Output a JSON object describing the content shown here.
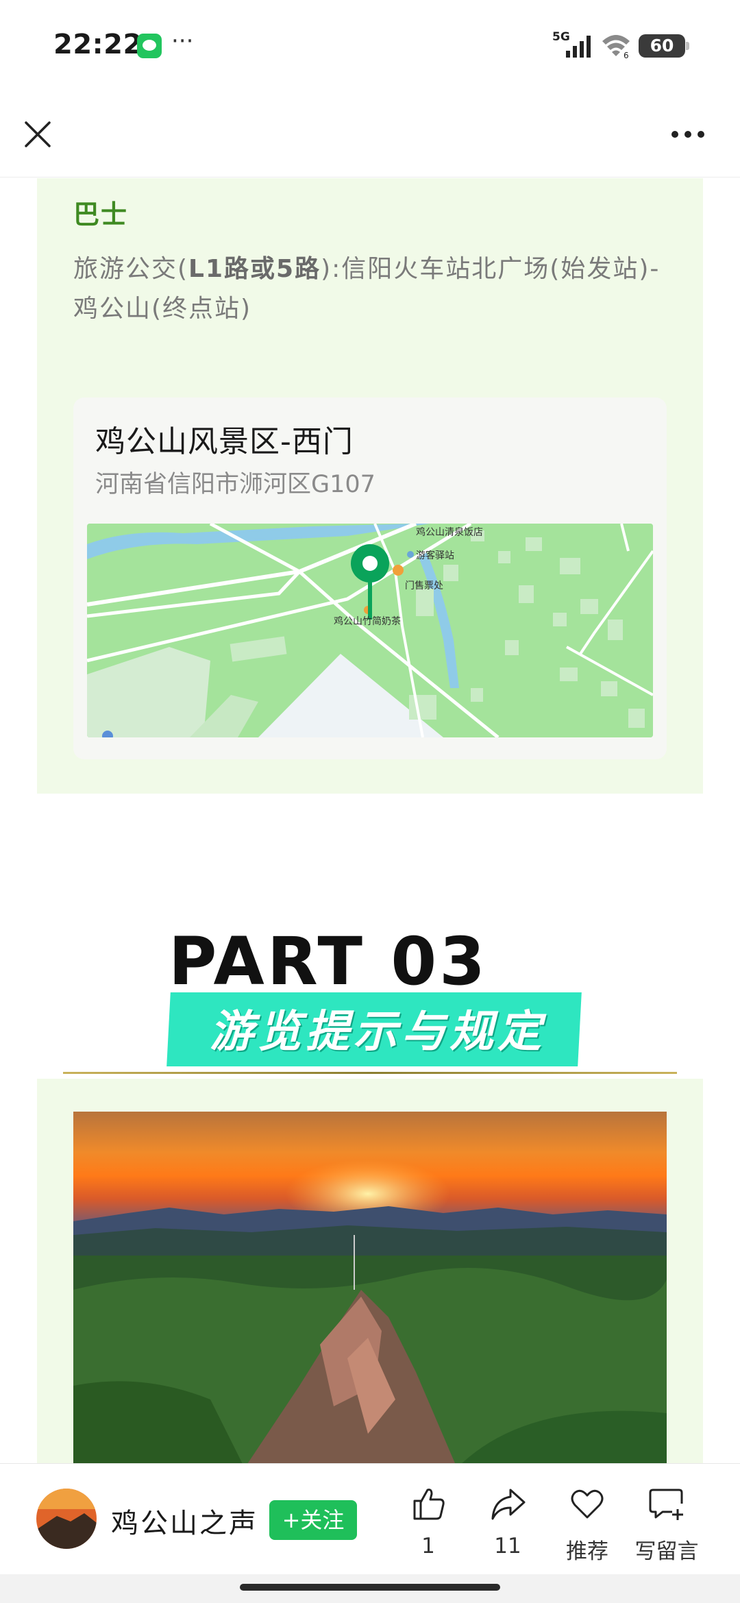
{
  "status_bar": {
    "time": "22:22",
    "network": "5G",
    "wifi_sub": "6",
    "battery": "60",
    "notification_icons": [
      "messages-icon",
      "more-dots-icon"
    ]
  },
  "nav": {
    "close_icon": "close-icon",
    "more_icon": "more-options-icon"
  },
  "bus": {
    "title": "巴士",
    "desc_prefix": "旅游公交(",
    "desc_route": "L1路或5路",
    "desc_suffix": "):信阳火车站北广场(始发站)-鸡公山(终点站)"
  },
  "map_card": {
    "name": "鸡公山风景区-西门",
    "address": "河南省信阳市浉河区G107",
    "labels": [
      "鸡公山清泉饭店",
      "游客驿站",
      "门售票处",
      "鸡公山竹简奶茶"
    ]
  },
  "part": {
    "title": "PART 03",
    "subtitle": "游览提示与规定"
  },
  "photo": {
    "description_icon": "mountain-sunset-photo"
  },
  "bottom_bar": {
    "account_name": "鸡公山之声",
    "follow_label": "+关注",
    "like_count": "1",
    "share_count": "11",
    "recommend_label": "推荐",
    "comment_label": "写留言"
  },
  "colors": {
    "panel_bg": "#f1fae8",
    "bus_title": "#3f8a22",
    "follow_button": "#1fbf5a",
    "subtitle_bg": "#2ee6c0"
  }
}
